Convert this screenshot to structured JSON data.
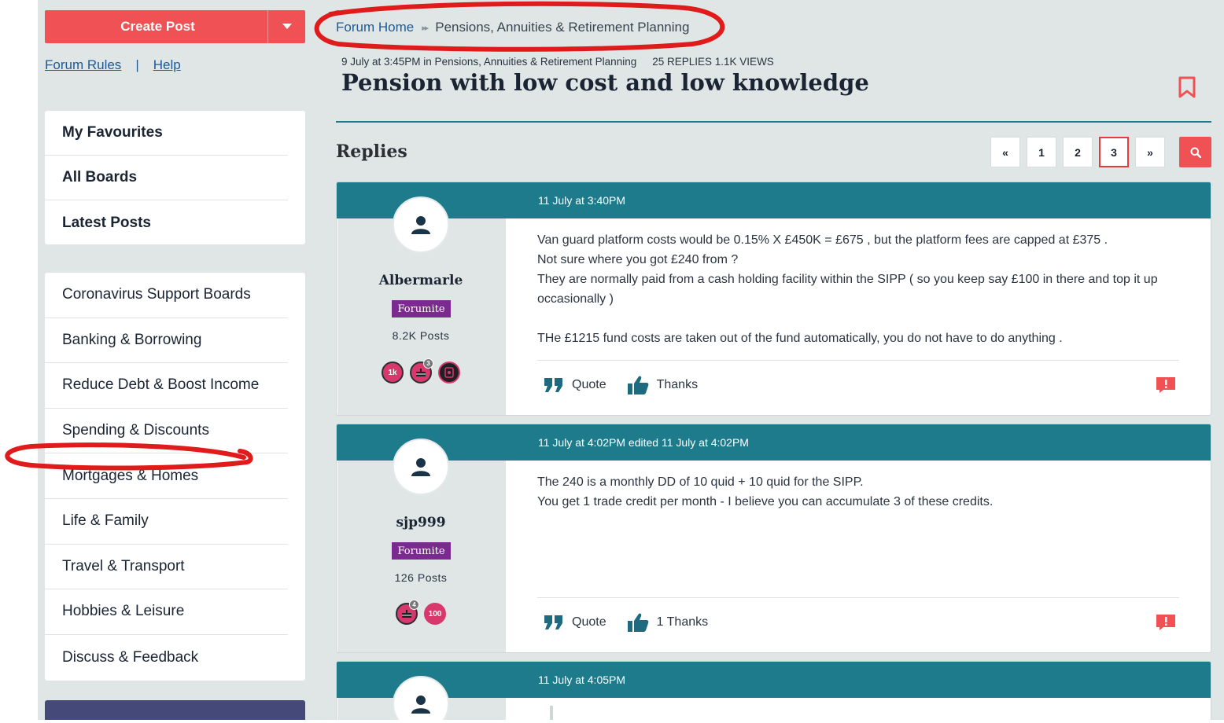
{
  "sidebar": {
    "create_post": "Create Post",
    "forum_rules": "Forum Rules",
    "separator": "|",
    "help": "Help",
    "favourites": [
      {
        "label": "My Favourites"
      },
      {
        "label": "All Boards"
      },
      {
        "label": "Latest Posts"
      }
    ],
    "boards": [
      {
        "label": "Coronavirus Support Boards"
      },
      {
        "label": "Banking & Borrowing"
      },
      {
        "label": "Reduce Debt & Boost Income"
      },
      {
        "label": "Spending & Discounts"
      },
      {
        "label": "Mortgages & Homes"
      },
      {
        "label": "Life & Family"
      },
      {
        "label": "Travel & Transport"
      },
      {
        "label": "Hobbies & Leisure"
      },
      {
        "label": "Discuss & Feedback"
      }
    ]
  },
  "breadcrumb": {
    "home": "Forum Home",
    "arrow": "▸▸",
    "current": "Pensions, Annuities & Retirement Planning"
  },
  "thread": {
    "date": "9 July at 3:45PM in Pensions, Annuities & Retirement Planning",
    "replies_count": "25 REPLIES",
    "views": "1.1K VIEWS",
    "title": "Pension with low cost and low knowledge"
  },
  "replies_heading": "Replies",
  "pagination": {
    "first": "«",
    "pages": [
      "1",
      "2",
      "3"
    ],
    "active_page": "3",
    "last": "»"
  },
  "colors": {
    "accent_red": "#f05154",
    "teal": "#1e7b8c",
    "rank_purple": "#7b2b8f",
    "annotation_red": "#e01b1b"
  },
  "posts": [
    {
      "header": "11 July at 3:40PM",
      "username": "Albermarle",
      "rank": "Forumite",
      "post_count": "8.2K Posts",
      "badges": [
        {
          "icon": "1k-badge-icon",
          "text": "1k"
        },
        {
          "icon": "cake-badge-icon",
          "text": "",
          "count": "3"
        },
        {
          "icon": "phone-badge-icon",
          "text": ""
        }
      ],
      "body": [
        "Van guard platform costs would be 0.15% X  £450K = £675 , but the platform fees are capped at £375  .",
        "Not sure where you got £240 from ?",
        "They are normally paid from a cash holding facility within the SIPP ( so you keep say £100 in there and top it up occasionally )",
        "",
        "THe £1215 fund costs are taken out of the fund automatically, you do not have to do anything ."
      ],
      "quote_label": "Quote",
      "thanks_label": "Thanks"
    },
    {
      "header": "11 July at 4:02PM edited 11 July at 4:02PM",
      "username": "sjp999",
      "rank": "Forumite",
      "post_count": "126 Posts",
      "badges": [
        {
          "icon": "cake-badge-icon",
          "text": "",
          "count": "4"
        },
        {
          "icon": "100-badge-icon",
          "text": "100"
        }
      ],
      "body": [
        "The 240 is a monthly DD of 10 quid + 10 quid for the SIPP.",
        "You get 1 trade credit per month - I believe you can accumulate 3 of these credits."
      ],
      "quote_label": "Quote",
      "thanks_label": "1 Thanks"
    },
    {
      "header": "11 July at 4:05PM"
    }
  ]
}
